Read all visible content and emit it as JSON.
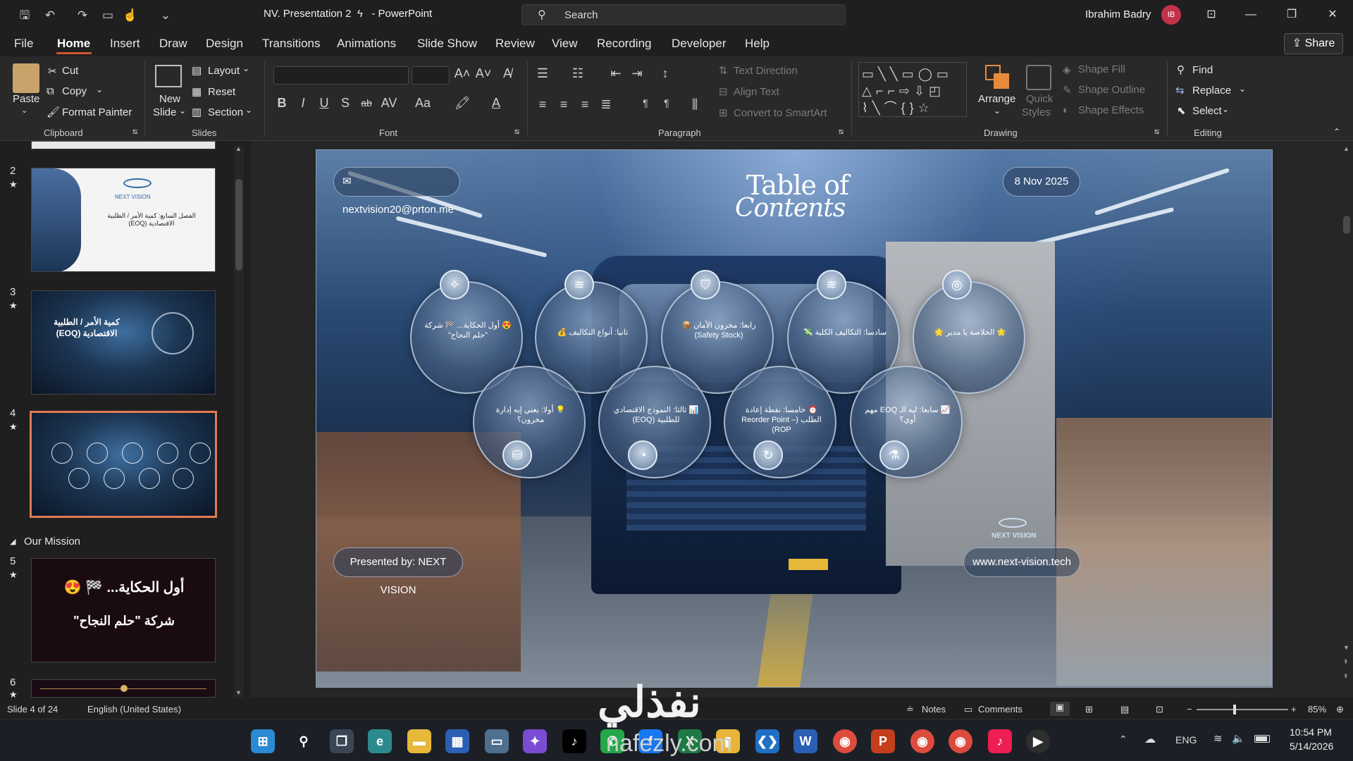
{
  "titlebar": {
    "doc_title": "NV. Presentation 2",
    "app_name": "- PowerPoint",
    "search_label": "Search",
    "user_name": "Ibrahim Badry",
    "avatar_initials": "IB"
  },
  "menu": {
    "tabs": [
      "File",
      "Home",
      "Insert",
      "Draw",
      "Design",
      "Transitions",
      "Animations",
      "Slide Show",
      "Review",
      "View",
      "Recording",
      "Developer",
      "Help"
    ],
    "share_label": "Share"
  },
  "ribbon": {
    "clipboard": {
      "paste": "Paste",
      "cut": "Cut",
      "copy": "Copy",
      "format_painter": "Format Painter",
      "group": "Clipboard"
    },
    "slides": {
      "new_slide_1": "New",
      "new_slide_2": "Slide",
      "layout": "Layout",
      "reset": "Reset",
      "section": "Section",
      "group": "Slides"
    },
    "font": {
      "group": "Font",
      "bold": "B",
      "italic": "I",
      "underline": "U",
      "shadow": "S",
      "strike": "ab",
      "spacing": "AV",
      "case": "Aa"
    },
    "paragraph": {
      "group": "Paragraph",
      "text_direction": "Text Direction",
      "align_text": "Align Text",
      "convert_smartart": "Convert to SmartArt"
    },
    "drawing": {
      "group": "Drawing",
      "arrange": "Arrange",
      "quick_styles_1": "Quick",
      "quick_styles_2": "Styles",
      "shape_fill": "Shape Fill",
      "shape_outline": "Shape Outline",
      "shape_effects": "Shape Effects"
    },
    "editing": {
      "group": "Editing",
      "find": "Find",
      "replace": "Replace",
      "select": "Select"
    }
  },
  "slide_pane": {
    "slides": [
      {
        "num": "2",
        "star": "★"
      },
      {
        "num": "3",
        "star": "★"
      },
      {
        "num": "4",
        "star": "★"
      },
      {
        "num": "5",
        "star": "★"
      },
      {
        "num": "6",
        "star": "★"
      }
    ],
    "section_label": "Our Mission",
    "thumb2_text": "الفصل السابع: كمية الأمر / الطلبية الاقتصادية (EOQ)",
    "thumb2_brand": "NEXT VISION",
    "thumb3_text": "كمية الأمر / الطلبية الاقتصادية (EOQ)",
    "thumb5_line1": "أول الحكاية... 🏁 😍",
    "thumb5_line2": "شركة \"حلم النجاح\""
  },
  "slide": {
    "email": "nextvision20@prton.me",
    "date": "8 Nov 2025",
    "title_line1": "Table of",
    "title_line2": "Contents",
    "presented_by": "Presented by: NEXT VISION",
    "website": "www.next-vision.tech",
    "brand": "NEXT VISION",
    "top_bubbles": [
      "😍 أول الحكاية... 🏁 شركة \"حلم النجاح\"",
      "ثانيا: أنواع التكاليف 💰",
      "رابعا: مخزون الأمان 📦 (Safety Stock)",
      "سادسا: التكاليف الكلية 💸",
      "🌟 الخلاصة يا مدير 🌟"
    ],
    "bottom_bubbles": [
      "💡 أولا: يعني إيه إدارة مخزون؟",
      "📊 ثالثا: النموذج الاقتصادي للطلبية (EOQ)",
      "⏰ خامسا: نقطة إعادة الطلب (Reorder Point – ROP)",
      "📈 سابعا: ليه الـ EOQ مهم أوي؟"
    ]
  },
  "statusbar": {
    "slide_info": "Slide 4 of 24",
    "language": "English (United States)",
    "notes": "Notes",
    "comments": "Comments",
    "zoom": "85%"
  },
  "taskbar": {
    "lang": "ENG",
    "time": "10:54 PM",
    "date": "5/14/2026"
  },
  "watermark": {
    "arabic": "نفذلي",
    "latin": "nafezly.com"
  },
  "colors": {
    "accent": "#d35230",
    "selection": "#e27a55",
    "avatar": "#c4314b"
  }
}
